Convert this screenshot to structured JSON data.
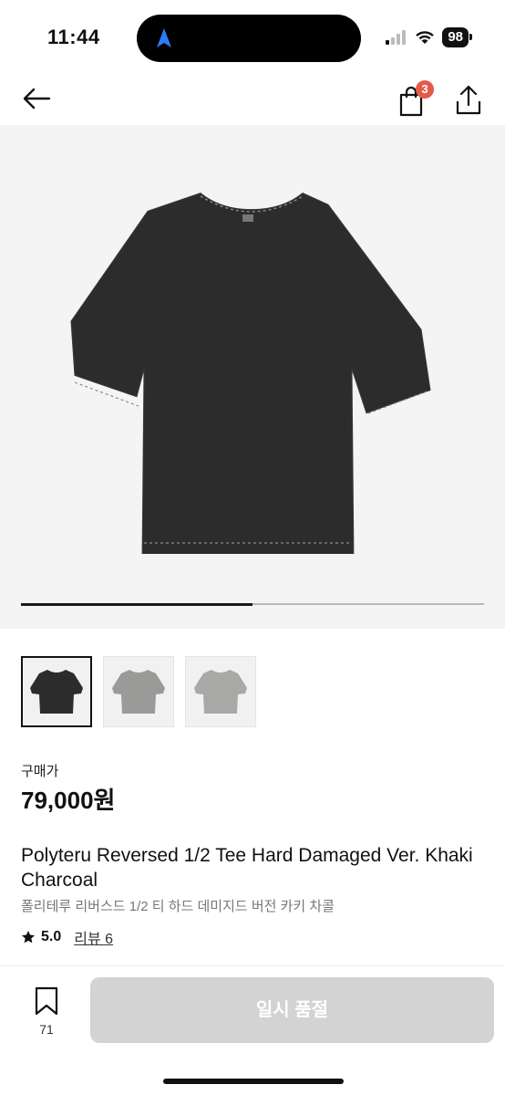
{
  "status_bar": {
    "time": "11:44",
    "battery": "98"
  },
  "header": {
    "cart_count": "3",
    "icons": {
      "back": "back-arrow-icon",
      "cart": "shopping-bag-icon",
      "share": "share-icon"
    }
  },
  "gallery": {
    "progress": 0.5,
    "thumbnails": [
      {
        "color": "#2c2c2c",
        "active": true
      },
      {
        "color": "#9a9a98",
        "active": false
      },
      {
        "color": "#a8a8a6",
        "active": false
      }
    ]
  },
  "product": {
    "price_label": "구매가",
    "price": "79,000원",
    "title": "Polyteru Reversed 1/2 Tee Hard Damaged Ver. Khaki Charcoal",
    "subtitle": "폴리테루 리버스드 1/2 티 하드 데미지드 버전 카키 차콜",
    "rating": "5.0",
    "review_label": "리뷰 6"
  },
  "bottom_bar": {
    "bookmark_count": "71",
    "soldout_label": "일시 품절"
  },
  "colors": {
    "badge": "#e35a48",
    "button_disabled": "#d3d3d3",
    "shirt": "#2c2c2c"
  }
}
